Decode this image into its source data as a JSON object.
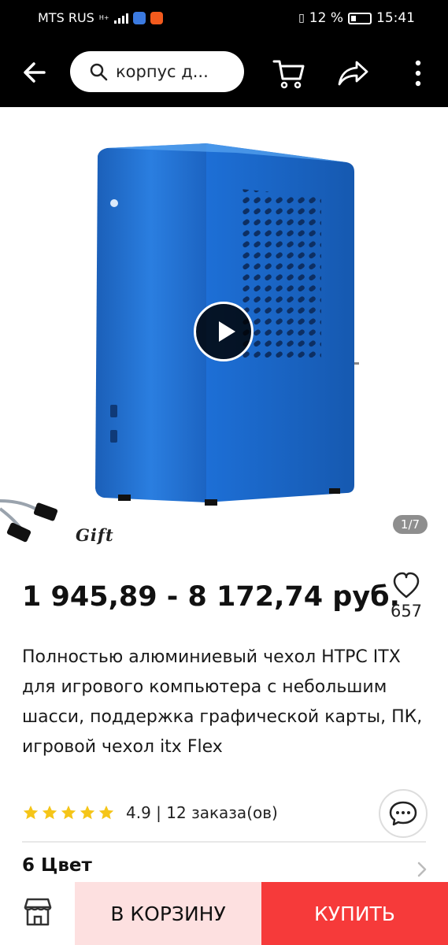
{
  "status_bar": {
    "carrier": "MTS RUS",
    "network": "H+",
    "battery": "12 %",
    "time": "15:41"
  },
  "header": {
    "search_text": "корпус д...",
    "icons": [
      "back-arrow-icon",
      "search-icon",
      "cart-icon",
      "share-icon",
      "more-vertical-icon"
    ]
  },
  "gallery": {
    "gift_label": "Gift",
    "counter": "1/7",
    "product_color": "#1e6fd0"
  },
  "product": {
    "price": "1 945,89 - 8 172,74 руб.",
    "wishlist_count": "657",
    "title": "Полностью алюминиевый чехол HTPC ITX для игрового компьютера с небольшим шасси, поддержка графической карты, ПК, игровой чехол itx Flex",
    "rating": "4.9",
    "orders": "| 12 заказа(ов)",
    "stars": 5,
    "colors_label": "6 Цвет"
  },
  "bottom": {
    "add_to_cart": "В КОРЗИНУ",
    "buy": "КУПИТЬ"
  },
  "colors": {
    "accent": "#f63a3a",
    "cart_bg": "#fde0e0",
    "star": "#f5c518"
  }
}
